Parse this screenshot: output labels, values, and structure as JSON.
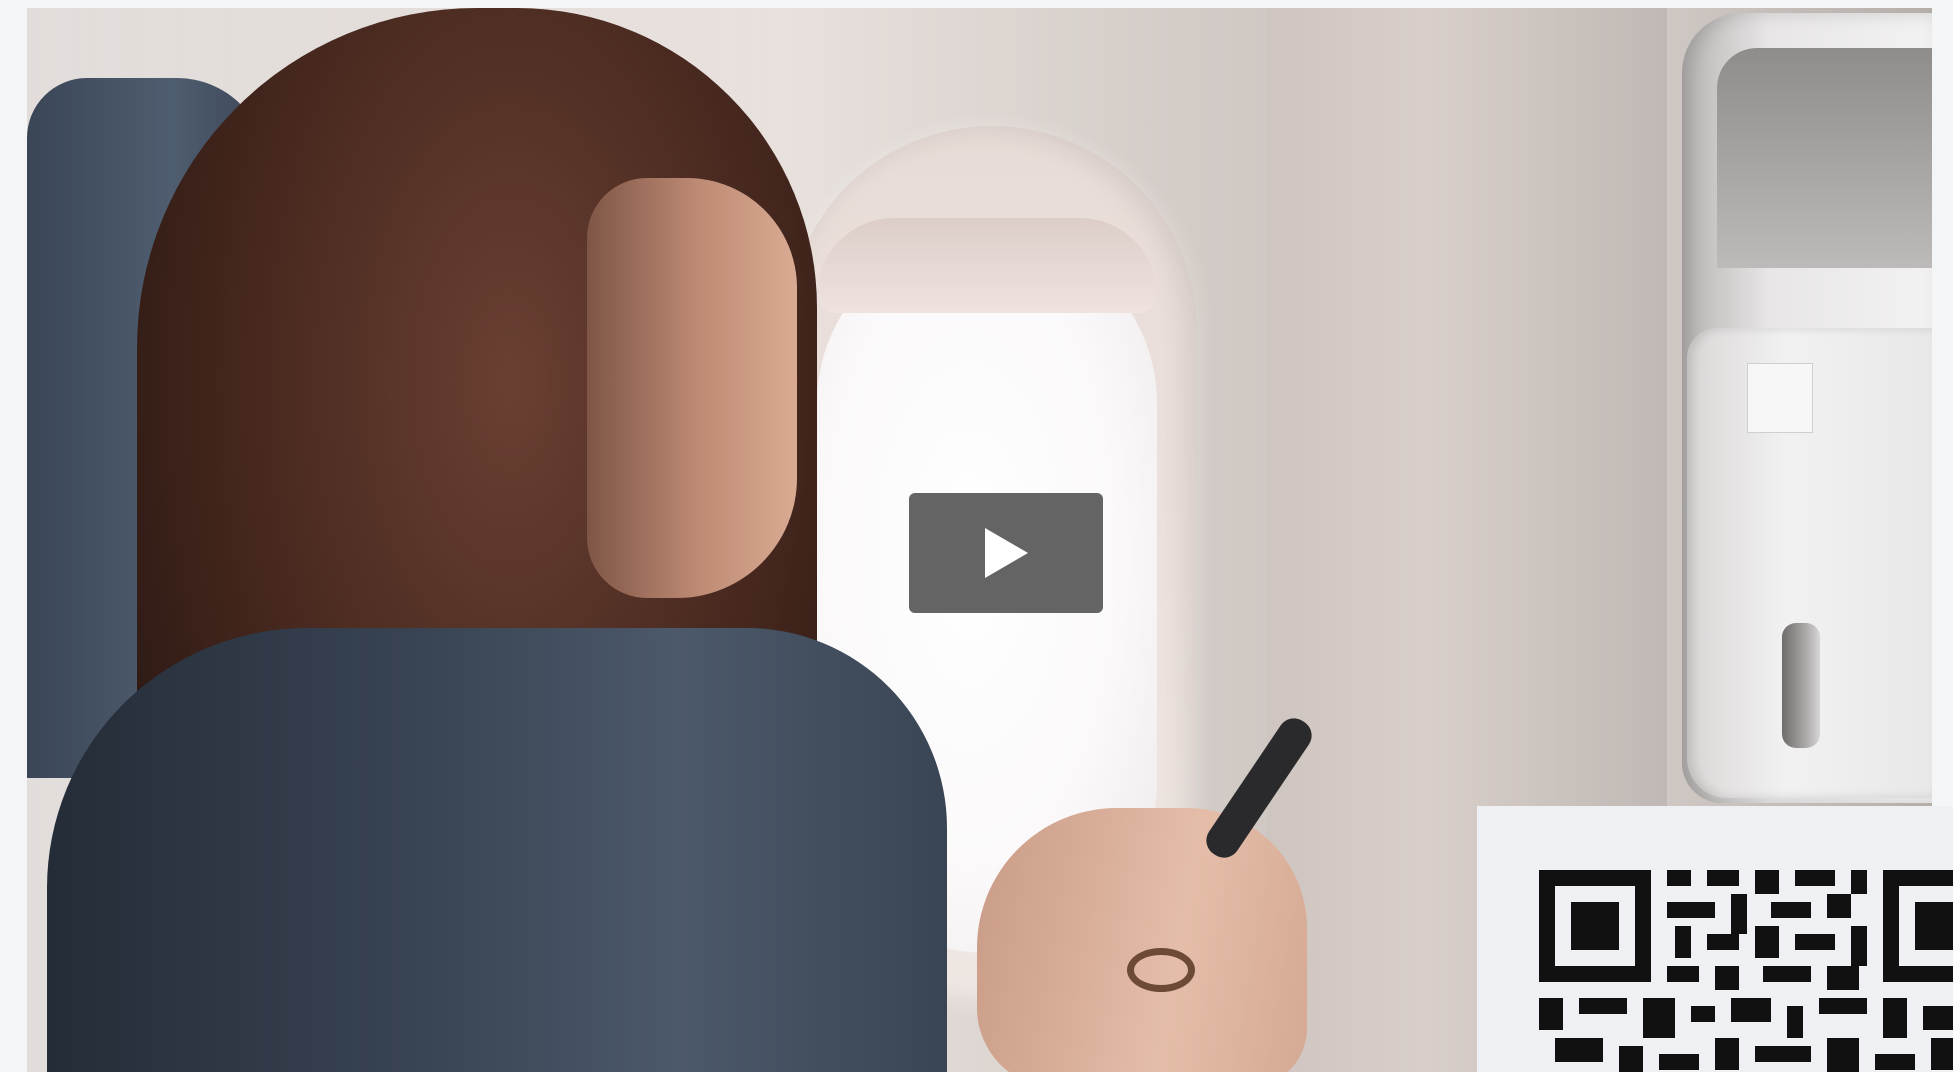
{
  "video": {
    "subject": "woman-using-phone-on-airplane",
    "play_icon": "play-icon",
    "play_label": ""
  },
  "qr": {
    "icon": "qr-code-icon"
  },
  "colors": {
    "page_background": "#f4f5f7",
    "play_button": "#5c5c5c",
    "qr_background": "#eef0f3",
    "qr_modules": "#111111"
  }
}
